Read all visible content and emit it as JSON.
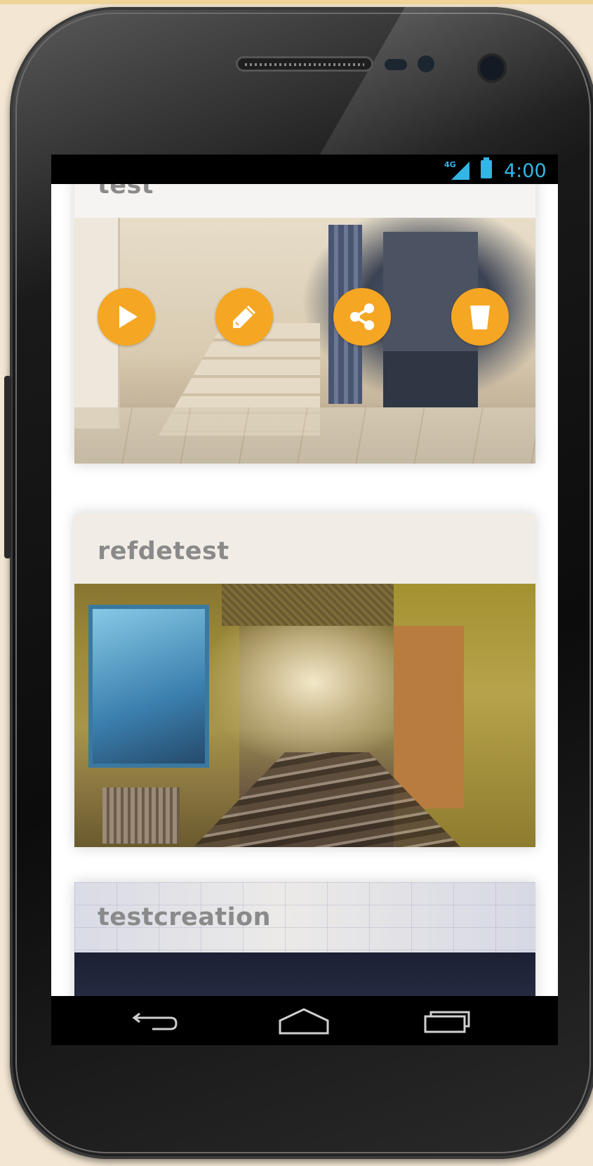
{
  "status_bar": {
    "network": "4G",
    "time": "4:00",
    "accent_color": "#33b5e5"
  },
  "actions": {
    "accent_color": "#f5a623",
    "buttons": [
      {
        "icon": "play-icon"
      },
      {
        "icon": "pencil-icon"
      },
      {
        "icon": "share-icon"
      },
      {
        "icon": "trash-icon"
      }
    ]
  },
  "tours": [
    {
      "title": "test"
    },
    {
      "title": "refdetest"
    },
    {
      "title": "testcreation"
    }
  ],
  "nav_bar": {
    "back_icon": "back-icon",
    "home_icon": "home-icon",
    "recents_icon": "recent-apps-icon"
  }
}
